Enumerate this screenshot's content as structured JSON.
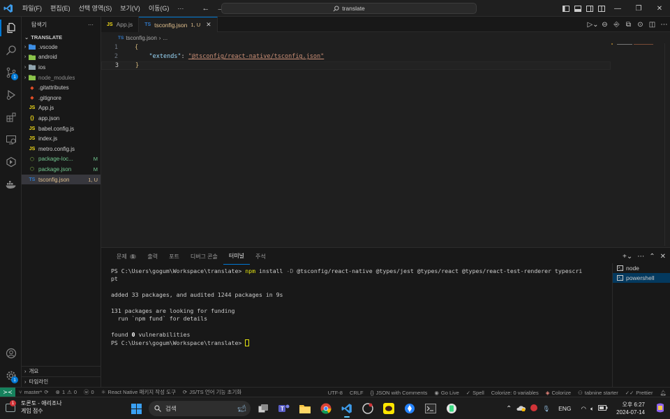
{
  "window": {
    "menu": [
      "파일(F)",
      "편집(E)",
      "선택 영역(S)",
      "보기(V)",
      "이동(G)",
      "···"
    ],
    "search_text": "translate"
  },
  "activity_bar": {
    "items": [
      "explorer",
      "search",
      "source-control",
      "run-debug",
      "extensions",
      "remote-explorer",
      "testing",
      "docker"
    ],
    "scm_badge": "1",
    "settings_badge": "1"
  },
  "sidebar": {
    "title": "탐색기",
    "more": "···",
    "folder": "TRANSLATE",
    "items": [
      {
        "name": ".vscode",
        "type": "folder",
        "color": "#cccccc",
        "icon_color": "#3d8ee5"
      },
      {
        "name": "android",
        "type": "folder",
        "color": "#cccccc",
        "icon_color": "#8bc34a"
      },
      {
        "name": "ios",
        "type": "folder",
        "color": "#cccccc",
        "icon_color": "#90a4ae"
      },
      {
        "name": "node_modules",
        "type": "folder",
        "color": "#8c8c8c",
        "icon_color": "#8bc34a"
      },
      {
        "name": ".gitattributes",
        "type": "file",
        "color": "#cccccc",
        "icon_color": "#e44d26",
        "icon": "◆"
      },
      {
        "name": ".gitignore",
        "type": "file",
        "color": "#cccccc",
        "icon_color": "#e44d26",
        "icon": "◆"
      },
      {
        "name": "App.js",
        "type": "file",
        "color": "#cccccc",
        "icon_color": "#f5de19",
        "icon": "JS"
      },
      {
        "name": "app.json",
        "type": "file",
        "color": "#cccccc",
        "icon_color": "#f5de19",
        "icon": "{}"
      },
      {
        "name": "babel.config.js",
        "type": "file",
        "color": "#cccccc",
        "icon_color": "#f5de19",
        "icon": "JS"
      },
      {
        "name": "index.js",
        "type": "file",
        "color": "#cccccc",
        "icon_color": "#f5de19",
        "icon": "JS"
      },
      {
        "name": "metro.config.js",
        "type": "file",
        "color": "#cccccc",
        "icon_color": "#f5de19",
        "icon": "JS"
      },
      {
        "name": "package-loc...",
        "type": "file",
        "color": "#73c991",
        "icon_color": "#8bc34a",
        "icon": "⬡",
        "mark": "M"
      },
      {
        "name": "package.json",
        "type": "file",
        "color": "#73c991",
        "icon_color": "#8bc34a",
        "icon": "⬡",
        "mark": "M"
      },
      {
        "name": "tsconfig.json",
        "type": "file",
        "color": "#e2c08d",
        "icon_color": "#3178c6",
        "icon": "TS",
        "mark": "1, U",
        "selected": true
      }
    ],
    "outline": "개요",
    "timeline": "타임라인"
  },
  "tabs": [
    {
      "label": "App.js",
      "suffix": "",
      "active": false,
      "icon": "JS",
      "icon_color": "#f5de19"
    },
    {
      "label": "tsconfig.json",
      "suffix": "1, U",
      "active": true,
      "icon": "TS",
      "icon_color": "#3178c6"
    }
  ],
  "breadcrumb": {
    "file": "tsconfig.json",
    "rest": "..."
  },
  "editor": {
    "lines": [
      {
        "n": "1",
        "parts": [
          {
            "t": "{",
            "c": "#d7ba7d"
          }
        ]
      },
      {
        "n": "2",
        "parts": [
          {
            "t": "    ",
            "c": "#cccccc"
          },
          {
            "t": "\"extends\"",
            "c": "#9cdcfe"
          },
          {
            "t": ": ",
            "c": "#cccccc"
          },
          {
            "t": "\"@tsconfig/react-native/tsconfig.json\"",
            "c": "#ce9178",
            "u": true
          }
        ]
      },
      {
        "n": "3",
        "parts": [
          {
            "t": "}",
            "c": "#d7ba7d"
          }
        ],
        "current": true
      }
    ]
  },
  "panel": {
    "tabs": [
      {
        "label": "문제",
        "count": "1",
        "active": false
      },
      {
        "label": "출력",
        "active": false
      },
      {
        "label": "포트",
        "active": false
      },
      {
        "label": "디버그 콘솔",
        "active": false
      },
      {
        "label": "터미널",
        "active": true
      },
      {
        "label": "주석",
        "active": false
      }
    ],
    "terminal_lines": [
      [
        {
          "t": "PS C:\\Users\\gogum\\Workspace\\translate> "
        },
        {
          "t": "npm",
          "c": "#e5e510"
        },
        {
          "t": " install "
        },
        {
          "t": "-D",
          "c": "#8c8c8c"
        },
        {
          "t": " @tsconfig/react-native @types/jest @types/react @types/react-test-renderer typescri"
        }
      ],
      [
        {
          "t": "pt"
        }
      ],
      [
        {
          "t": ""
        }
      ],
      [
        {
          "t": "added 33 packages, and audited 1244 packages in 9s"
        }
      ],
      [
        {
          "t": ""
        }
      ],
      [
        {
          "t": "131 packages are looking for funding"
        }
      ],
      [
        {
          "t": "  run `npm fund` for details"
        }
      ],
      [
        {
          "t": ""
        }
      ],
      [
        {
          "t": "found "
        },
        {
          "t": "0",
          "c": "#ffffff",
          "b": true
        },
        {
          "t": " vulnerabilities"
        }
      ],
      [
        {
          "t": "PS C:\\Users\\gogum\\Workspace\\translate> "
        }
      ]
    ],
    "terminals": [
      {
        "label": "node",
        "selected": false
      },
      {
        "label": "powershell",
        "selected": true
      }
    ]
  },
  "statusbar": {
    "branch": "master*",
    "sync": "⟳",
    "errors": "1",
    "warnings": "0",
    "ports": "0",
    "task": "React Native 패키지 작성 도구",
    "jsts": "JS/TS 언어 기능 초기화",
    "encoding": "UTF-8",
    "eol": "CRLF",
    "language": "JSON with Comments",
    "golive": "Go Live",
    "spell": "Spell",
    "colorize_vars": "Colorize: 0 variables",
    "colorize": "Colorize",
    "tabnine": "tabnine starter",
    "prettier": "Prettier"
  },
  "taskbar": {
    "weather_title": "토론토 - 애리조나",
    "weather_sub": "게임 점수",
    "weather_badge": "1",
    "search": "검색",
    "lang": "ENG",
    "time": "오후 6:27",
    "date": "2024-07-14"
  }
}
